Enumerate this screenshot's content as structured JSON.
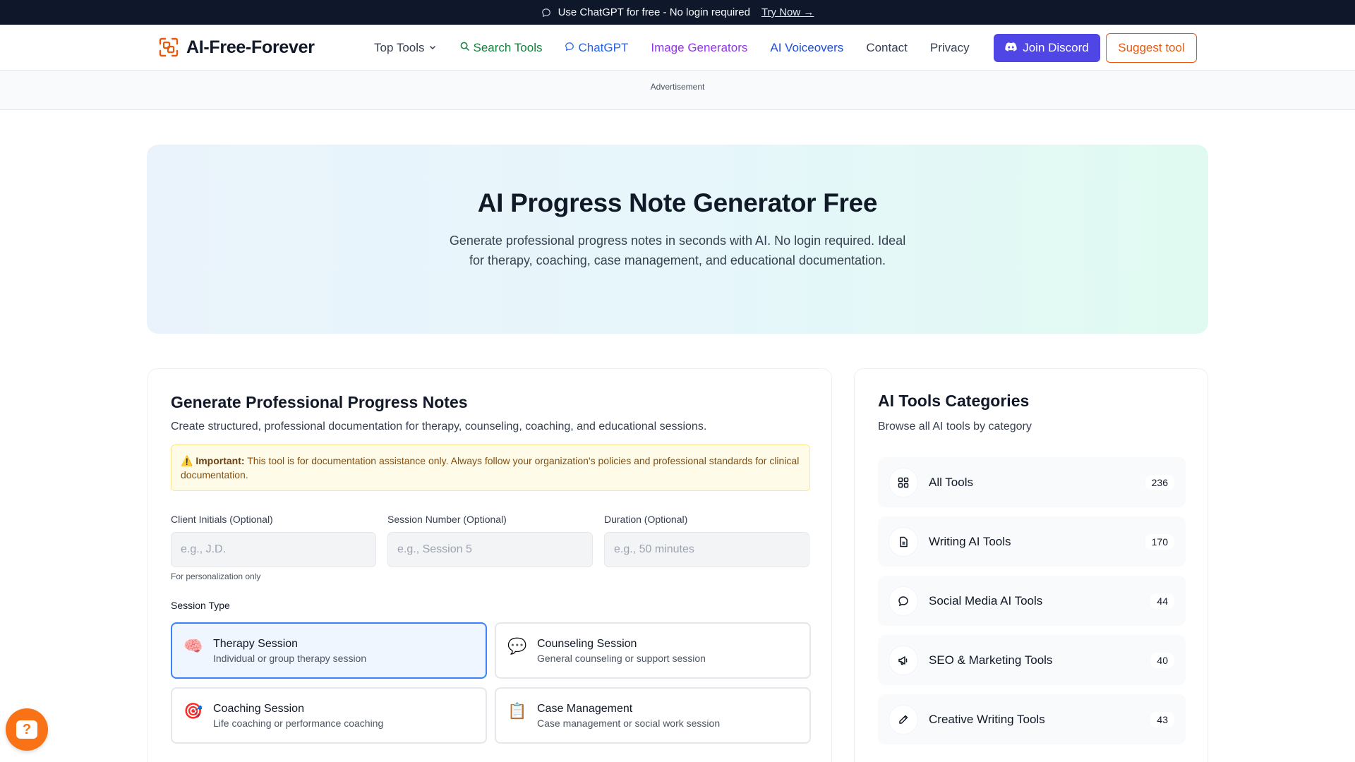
{
  "banner": {
    "text": "Use ChatGPT for free - No login required",
    "link": "Try Now →"
  },
  "header": {
    "logo_text": "AI-Free-Forever",
    "nav": {
      "top_tools": "Top Tools",
      "search_tools": "Search Tools",
      "chatgpt": "ChatGPT",
      "image_generators": "Image Generators",
      "ai_voiceovers": "AI Voiceovers",
      "contact": "Contact",
      "privacy": "Privacy"
    },
    "discord_label": "Join Discord",
    "suggest_label": "Suggest tool"
  },
  "ad": {
    "label": "Advertisement"
  },
  "hero": {
    "title": "AI Progress Note Generator Free",
    "subtitle": "Generate professional progress notes in seconds with AI. No login required. Ideal for therapy, coaching, case management, and educational documentation."
  },
  "form": {
    "title": "Generate Professional Progress Notes",
    "description": "Create structured, professional documentation for therapy, counseling, coaching, and educational sessions.",
    "warning_label": "Important:",
    "warning_text": "This tool is for documentation assistance only. Always follow your organization's policies and professional standards for clinical documentation.",
    "fields": [
      {
        "label": "Client Initials (Optional)",
        "placeholder": "e.g., J.D."
      },
      {
        "label": "Session Number (Optional)",
        "placeholder": "e.g., Session 5"
      },
      {
        "label": "Duration (Optional)",
        "placeholder": "e.g., 50 minutes"
      }
    ],
    "client_hint": "For personalization only",
    "session_type_label": "Session Type",
    "sessions": [
      {
        "emoji": "🧠",
        "title": "Therapy Session",
        "subtitle": "Individual or group therapy session",
        "selected": true
      },
      {
        "emoji": "💬",
        "title": "Counseling Session",
        "subtitle": "General counseling or support session",
        "selected": false
      },
      {
        "emoji": "🎯",
        "title": "Coaching Session",
        "subtitle": "Life coaching or performance coaching",
        "selected": false
      },
      {
        "emoji": "📋",
        "title": "Case Management",
        "subtitle": "Case management or social work session",
        "selected": false
      }
    ]
  },
  "sidebar": {
    "title": "AI Tools Categories",
    "subtitle": "Browse all AI tools by category",
    "categories": [
      {
        "icon": "grid-icon",
        "name": "All Tools",
        "count": "236"
      },
      {
        "icon": "document-icon",
        "name": "Writing AI Tools",
        "count": "170"
      },
      {
        "icon": "chat-bubble-icon",
        "name": "Social Media AI Tools",
        "count": "44"
      },
      {
        "icon": "megaphone-icon",
        "name": "SEO & Marketing Tools",
        "count": "40"
      },
      {
        "icon": "pencil-icon",
        "name": "Creative Writing Tools",
        "count": "43"
      }
    ]
  },
  "colors": {
    "banner_bg": "#0f172a",
    "discord": "#4f46e5",
    "suggest": "#ea580c",
    "selected_border": "#3b82f6",
    "help_button": "#f97316"
  }
}
